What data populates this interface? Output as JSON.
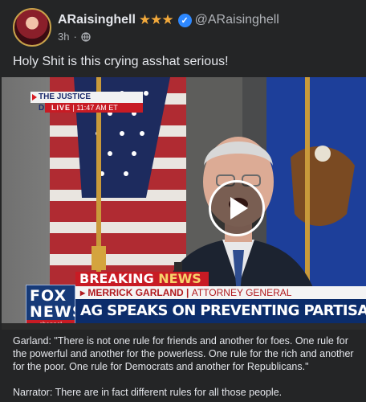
{
  "post": {
    "author_name": "ARaisinghell",
    "stars": "★★★",
    "handle": "@ARaisinghell",
    "time": "3h",
    "text": "Holy Shit is this crying asshat serious!"
  },
  "video": {
    "top_banner_title": "THE JUSTICE DEPARTMENT",
    "top_banner_live": "LIVE",
    "top_banner_time": "11:47 AM ET",
    "breaking_label": "BREAKING",
    "breaking_news": "NEWS",
    "name_bar_name": "MERRICK GARLAND",
    "name_bar_title": "ATTORNEY GENERAL",
    "headline": "AG SPEAKS ON PREVENTING PARTISAN INFLUENCE TO DOJ",
    "logo_fox": "FOX",
    "logo_news": "NEWS",
    "logo_channel": "channel"
  },
  "caption": {
    "line1": "Garland: \"There is not one rule for friends and another for foes. One rule for the powerful and another for the powerless. One rule for the rich and another for the poor. One rule for Democrats and another for Republicans.\"",
    "line2": "Narrator: There are in fact different rules for all those people."
  },
  "colors": {
    "background": "#242526",
    "verified": "#2d88ff",
    "stars": "#f2a93b",
    "fox_red": "#c81b24",
    "fox_navy": "#0c2d6b"
  },
  "icons": [
    "verified-badge-icon",
    "globe-icon",
    "play-icon"
  ]
}
